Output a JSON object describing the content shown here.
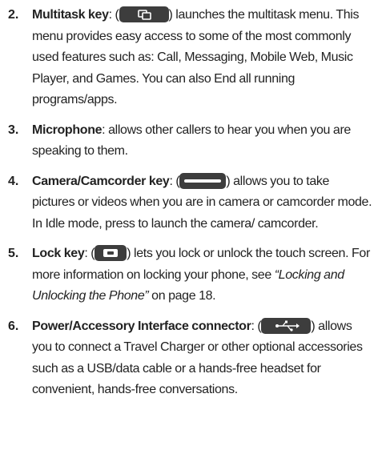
{
  "items": [
    {
      "number": "2.",
      "term": "Multitask key",
      "pre": ": (",
      "icon": "multitask-key-icon",
      "post": ") launches the multitask menu. This menu provides easy access to some of the most commonly used features such as: Call, Messaging, Mobile Web, Music Player, and Games. You can also End all running programs/apps."
    },
    {
      "number": "3.",
      "term": "Microphone",
      "post": ": allows other callers to hear you when you are speaking to them."
    },
    {
      "number": "4.",
      "term": "Camera/Camcorder key",
      "pre": ": (",
      "icon": "camera-key-icon",
      "post": ") allows you to take pictures or videos when you are in camera or camcorder mode. In Idle mode, press to launch the camera/ camcorder."
    },
    {
      "number": "5.",
      "term": "Lock key",
      "pre": ": (",
      "icon": "lock-key-icon",
      "post": ") lets you lock or unlock the touch screen. For more information on locking your phone, see ",
      "ref": "“Locking and Unlocking the Phone”",
      "tail": " on page 18."
    },
    {
      "number": "6.",
      "term": "Power/Accessory Interface connector",
      "pre": ": (",
      "icon": "usb-connector-icon",
      "post": ") allows you to connect a Travel Charger or other optional accessories such as a USB/data cable or a hands-free headset for convenient, hands-free conversations."
    }
  ],
  "colors": {
    "text": "#222222",
    "key_background": "#3d3d3d",
    "key_symbol": "#ffffff"
  }
}
